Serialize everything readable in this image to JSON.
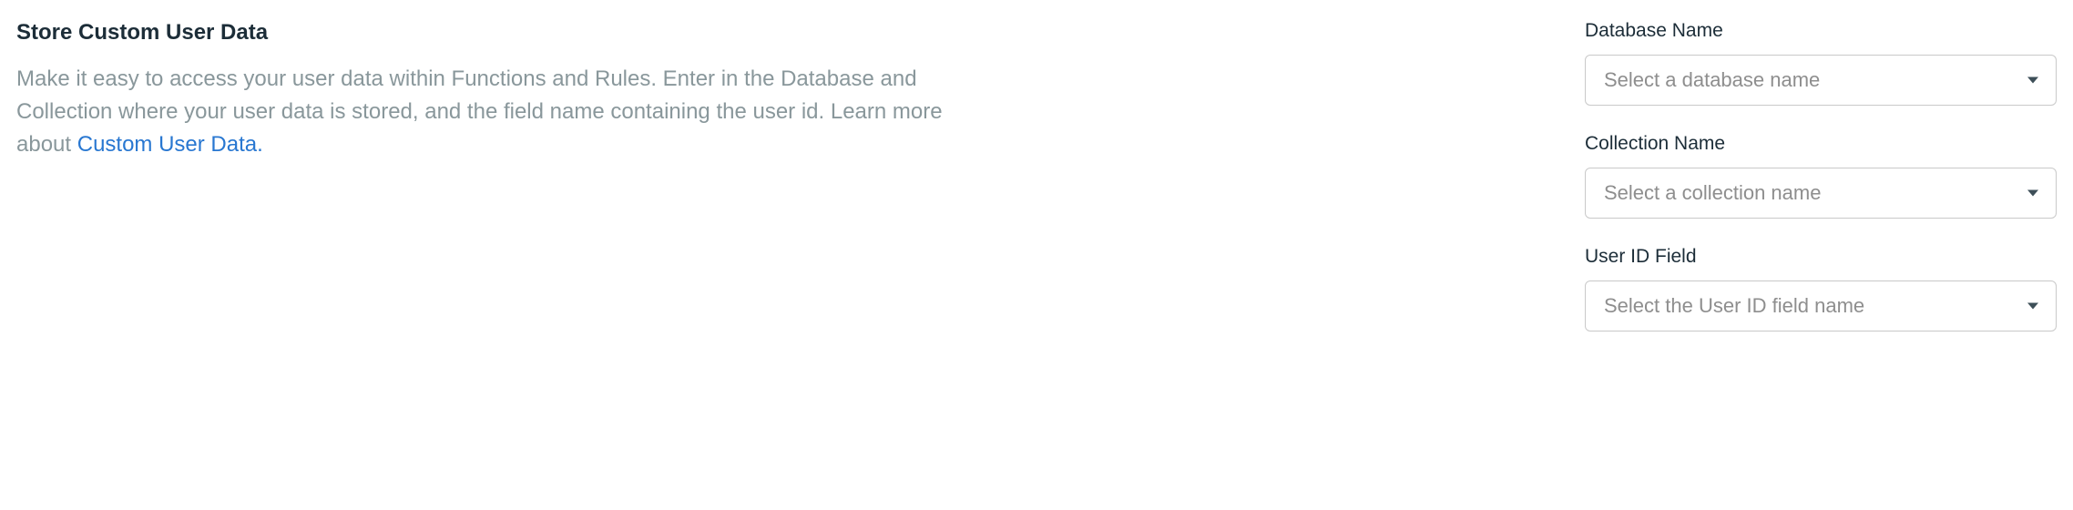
{
  "section": {
    "title": "Store Custom User Data",
    "description_part1": "Make it easy to access your user data within Functions and Rules. Enter in the Database and Collection where your user data is stored, and the field name containing the user id. Learn more about ",
    "description_link": "Custom User Data."
  },
  "form": {
    "database": {
      "label": "Database Name",
      "placeholder": "Select a database name"
    },
    "collection": {
      "label": "Collection Name",
      "placeholder": "Select a collection name"
    },
    "userid": {
      "label": "User ID Field",
      "placeholder": "Select the User ID field name"
    }
  }
}
